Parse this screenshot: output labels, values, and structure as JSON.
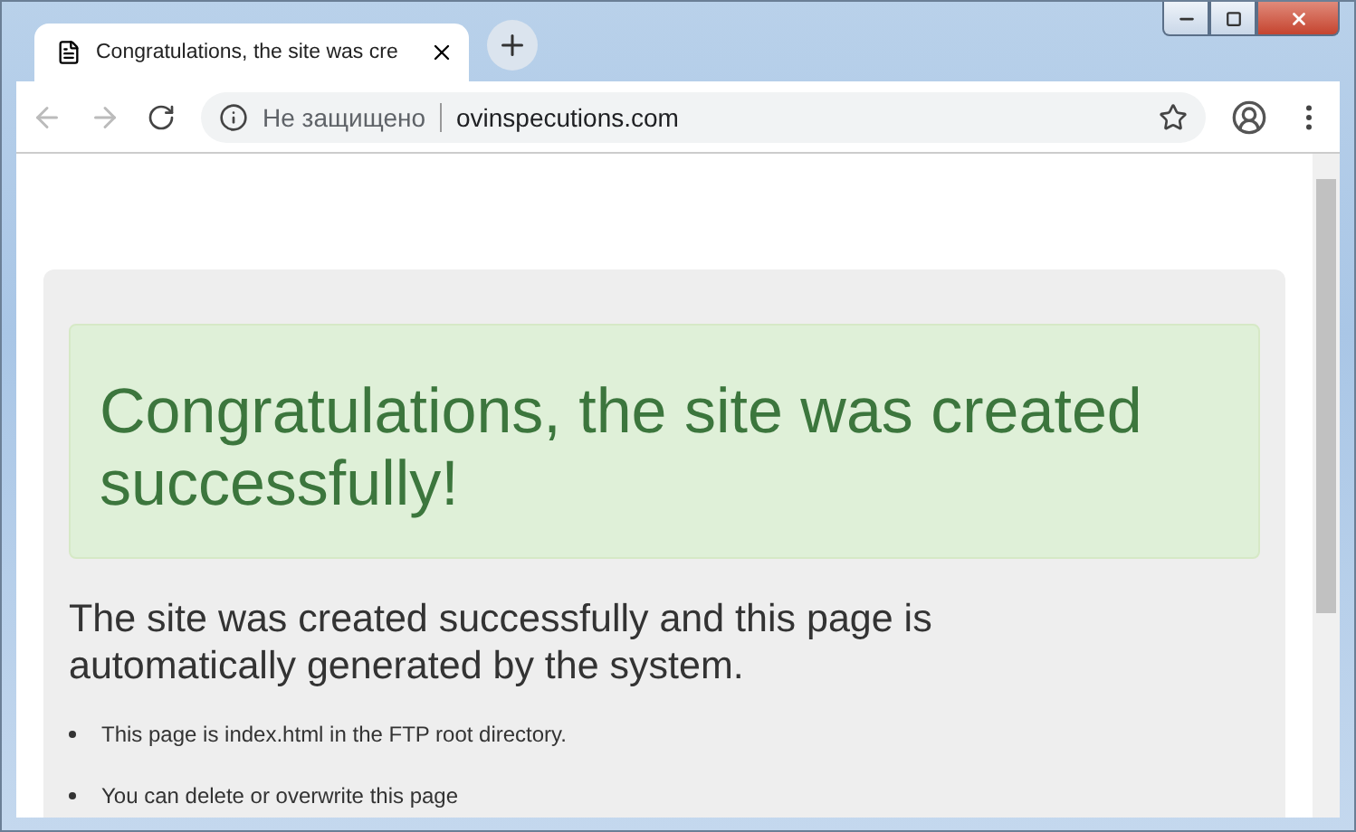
{
  "window": {
    "controls": [
      {
        "kind": "minimize"
      },
      {
        "kind": "maximize"
      },
      {
        "kind": "close"
      }
    ]
  },
  "tabs": [
    {
      "title": "Congratulations, the site was cre",
      "selected": true
    }
  ],
  "address_bar": {
    "security": "Не защищено",
    "url": "ovinspecutions.com"
  },
  "page": {
    "alert": "Congratulations, the site was created successfully!",
    "heading": "The site was created successfully and this page is automatically generated by the system.",
    "items": [
      "This page is index.html in the FTP root directory.",
      "You can delete or overwrite this page"
    ]
  }
}
